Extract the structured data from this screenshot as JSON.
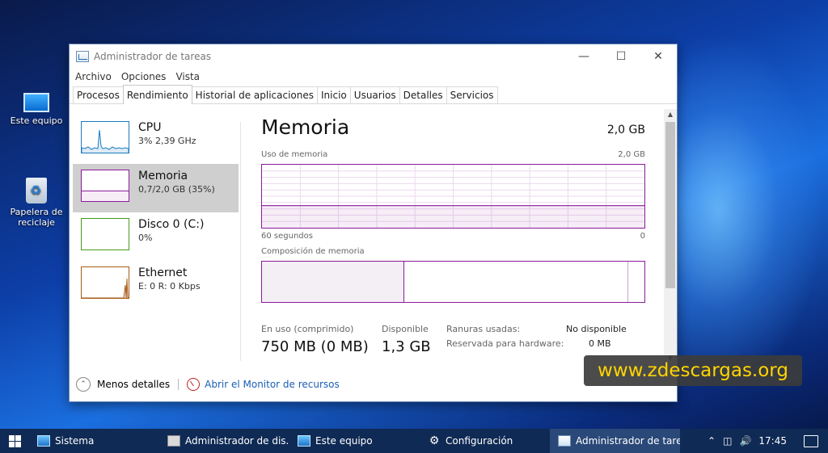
{
  "desktop": {
    "icons": [
      {
        "label": "Este equipo"
      },
      {
        "label": "Papelera de reciclaje"
      }
    ]
  },
  "window": {
    "title": "Administrador de tareas",
    "menu": [
      "Archivo",
      "Opciones",
      "Vista"
    ],
    "tabs": [
      "Procesos",
      "Rendimiento",
      "Historial de aplicaciones",
      "Inicio",
      "Usuarios",
      "Detalles",
      "Servicios"
    ],
    "active_tab": "Rendimiento"
  },
  "sidebar": {
    "items": [
      {
        "name": "CPU",
        "value": "3% 2,39 GHz",
        "color": "#1a7bbf"
      },
      {
        "name": "Memoria",
        "value": "0,7/2,0 GB (35%)",
        "color": "#8b1a9b"
      },
      {
        "name": "Disco 0 (C:)",
        "value": "0%",
        "color": "#4a9a1a"
      },
      {
        "name": "Ethernet",
        "value": "E: 0 R: 0 Kbps",
        "color": "#a85a14"
      }
    ]
  },
  "memory": {
    "title": "Memoria",
    "total": "2,0 GB",
    "usage_label": "Uso de memoria",
    "usage_max": "2,0 GB",
    "usage_fraction": 0.35,
    "time_left": "60 segundos",
    "time_right": "0",
    "composition_label": "Composición de memoria",
    "in_use_label": "En uso (comprimido)",
    "in_use_value": "750 MB (0 MB)",
    "available_label": "Disponible",
    "available_value": "1,3 GB",
    "slots_label": "Ranuras usadas:",
    "slots_value": "No disponible",
    "reserved_label": "Reservada para hardware:",
    "reserved_value": "0 MB"
  },
  "footer": {
    "less_details": "Menos detalles",
    "open_monitor": "Abrir el Monitor de recursos"
  },
  "watermark": "www.zdescargas.org",
  "taskbar": {
    "items": [
      "Sistema",
      "Administrador de dis...",
      "Este equipo",
      "Configuración",
      "Administrador de tare..."
    ],
    "time": "17:45"
  }
}
